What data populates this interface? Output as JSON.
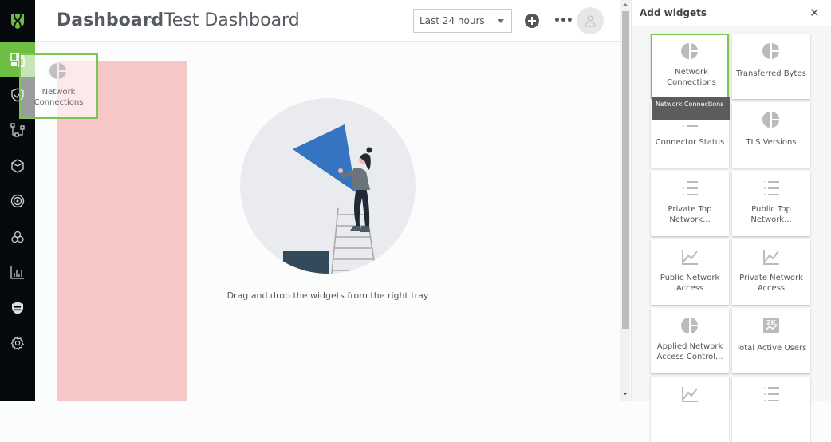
{
  "sidebar": {
    "logo": "shield-logo-icon",
    "items": [
      {
        "icon": "dashboard-icon",
        "active": true
      },
      {
        "icon": "shield-check-icon",
        "active": false
      },
      {
        "icon": "network-topology-icon",
        "active": false
      },
      {
        "icon": "cube-icon",
        "active": false
      },
      {
        "icon": "target-icon",
        "active": false
      },
      {
        "icon": "integrations-icon",
        "active": false
      },
      {
        "icon": "bar-chart-icon",
        "active": false
      },
      {
        "icon": "policy-shield-icon",
        "active": false
      },
      {
        "icon": "settings-gear-icon",
        "active": false
      }
    ]
  },
  "header": {
    "breadcrumb_root": "Dashboard",
    "breadcrumb_separator": "›",
    "breadcrumb_current": "Test Dashboard",
    "time_range": "Last 24 hours",
    "more_label": "•••"
  },
  "canvas": {
    "empty_message": "Drag and drop the widgets from the right tray",
    "drag_ghost": {
      "label": "Network Connections",
      "icon": "pie-chart-icon"
    }
  },
  "panel": {
    "title": "Add widgets",
    "close_label": "✕",
    "tooltip": "Network Connections",
    "widgets": [
      {
        "label": "Network Connections",
        "icon": "pie-chart-icon",
        "selected": true
      },
      {
        "label": "Transferred Bytes",
        "icon": "pie-chart-icon",
        "selected": false
      },
      {
        "label": "Connector Status",
        "icon": "ranked-list-icon",
        "selected": false
      },
      {
        "label": "TLS Versions",
        "icon": "pie-chart-icon",
        "selected": false
      },
      {
        "label": "Private Top Network...",
        "icon": "ranked-list-icon",
        "selected": false
      },
      {
        "label": "Public Top Network...",
        "icon": "ranked-list-icon",
        "selected": false
      },
      {
        "label": "Public Network Access",
        "icon": "line-chart-icon",
        "selected": false
      },
      {
        "label": "Private Network Access",
        "icon": "line-chart-icon",
        "selected": false
      },
      {
        "label": "Applied Network Access Control...",
        "icon": "pie-chart-icon",
        "selected": false
      },
      {
        "label": "Total Active Users",
        "icon": "kpi-trend-icon",
        "selected": false
      },
      {
        "label": "",
        "icon": "line-chart-icon",
        "selected": false
      },
      {
        "label": "",
        "icon": "ranked-list-icon",
        "selected": false
      }
    ]
  },
  "colors": {
    "accent": "#6fbe44",
    "sidebar_bg": "#05090b",
    "drop_zone": "#f7c7c7",
    "tooltip_bg": "#5c5c5c",
    "illustration_blue": "#3574c0"
  }
}
